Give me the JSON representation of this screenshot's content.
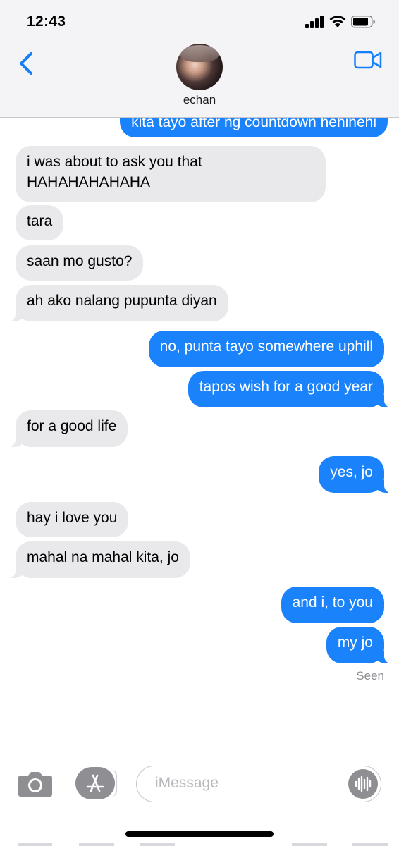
{
  "status_bar": {
    "time": "12:43"
  },
  "header": {
    "contact_name": "echan"
  },
  "messages": [
    {
      "dir": "out",
      "text": "kita tayo after ng countdown hehihehi"
    },
    {
      "dir": "in",
      "text": "i was about to ask you that",
      "text2": "HAHAHAHAHAHA"
    },
    {
      "dir": "in",
      "text": "tara"
    },
    {
      "dir": "in",
      "text": "saan mo gusto?"
    },
    {
      "dir": "in",
      "text": "ah ako nalang pupunta diyan"
    },
    {
      "dir": "out",
      "text": "no, punta tayo somewhere uphill"
    },
    {
      "dir": "out",
      "text": "tapos wish for a good year"
    },
    {
      "dir": "in",
      "text": "for a good life"
    },
    {
      "dir": "out",
      "text": "yes, jo"
    },
    {
      "dir": "in",
      "text": "hay i love you"
    },
    {
      "dir": "in",
      "text": "mahal na mahal kita, jo"
    },
    {
      "dir": "out",
      "text": "and i, to you"
    },
    {
      "dir": "out",
      "text": "my jo"
    }
  ],
  "seen_label": "Seen",
  "input": {
    "placeholder": "iMessage"
  },
  "icons": {
    "back": "chevron-left-icon",
    "video": "video-camera-icon",
    "camera": "camera-icon",
    "apps": "app-store-icon",
    "audio": "audio-waveform-icon"
  },
  "colors": {
    "outgoing": "#1a82fb",
    "incoming": "#e9e9eb",
    "accent": "#147efb"
  }
}
